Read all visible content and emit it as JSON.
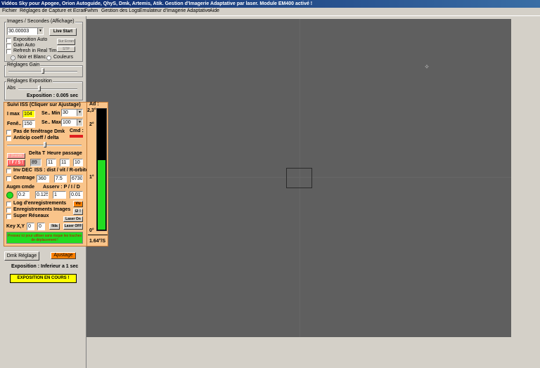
{
  "window": {
    "title": "Vidéos Sky pour Apogee, Orion Autoguide, QhyS, Dmk, Artemis, Atik.    Gestion d'Imagerie Adaptative par laser.    Module EM400 activé !"
  },
  "menu": [
    "Fichier",
    "Réglages de Capture et Ecran",
    "Fwhm",
    "Gestion des Logs",
    "Emulateur d'Imagerie Adaptative",
    "Aide"
  ],
  "images": {
    "group_label": "Images / Secondes (Affichage)",
    "fps_value": "30.00003",
    "live_start": "Live Start",
    "expo_auto": "Exposition Auto",
    "gain_auto": "Gain Auto",
    "refresh": "Refresh in Real Time",
    "sur_ecran": "Sur Ecran",
    "btn_disabled": "STP",
    "noir_blanc": "Noir et Blanc",
    "couleurs": "Couleurs"
  },
  "gain": {
    "group_label": "Réglages Gain",
    "level": 0.5
  },
  "exposure": {
    "group_label": "Réglages Exposition",
    "abs_label": "Abs",
    "level": 0.35,
    "readout": "Exposition :   0.005 sec"
  },
  "iss": {
    "title": "Suivi ISS (Cliquer sur Ajustage)",
    "imax_label": "I max",
    "imax_value": "104",
    "seuil_min_label": "Se.. Min",
    "seuil_min_value": "30",
    "fene_label": "Fenê..",
    "fene_value": "150",
    "seuil_max_label": "Se.. Max",
    "seuil_max_value": "100",
    "pas_fenetrage": "Pas de fenêtrage Dmk",
    "cmd_label": "Cmd :",
    "anticip": "Anticip coeff / delta",
    "btn_top_disabled": "F (Fenêtr.)",
    "btn_fs": "! F / S !",
    "delta_t_label": "Delta T",
    "heure_label": "Heure passage",
    "delta_t_value": "89",
    "hh": "11",
    "mm": "11",
    "ss": "10",
    "inv_dec": "Inv DEC",
    "iss_dist": "ISS : dist / vit / R-orbite",
    "centrage": "Centrage",
    "dist": "360",
    "vit": "7.5",
    "orbit": "6730",
    "augm_label": "Augm cmde",
    "asserv_label": "Asserv : P / I / D",
    "augm_value": "0.2",
    "p_value": "0.125",
    "i_value": "1",
    "d_value": "0.01",
    "log": "Log d'enregistrements",
    "vu": "Vu",
    "enreg": "Enregistrements Images",
    "d_btn": "D !",
    "super": "Super Réseaux",
    "laser_on": "Laser On",
    "key_label": "Key X,Y",
    "key_x": "0",
    "key_y": "0",
    "ilda": "Ilda",
    "laser_off": "Laser OFF",
    "green_msg": "Pressez ici pour utiliser sans risque les touches de déplacement !"
  },
  "ad": {
    "label": "Ad :",
    "t1": "2,3°",
    "t2": "2°",
    "t3": "1°",
    "t4": "0°",
    "speed": "1.64°/S",
    "level": 0.57
  },
  "bottom": {
    "dmk_reglage": "Dmk Réglage",
    "ajustage": "Ajustage",
    "expo_info": "Exposition : Inferieur a 1 sec",
    "expo_status": "EXPOSITION EN COURS !"
  },
  "colors": {
    "iss_panel": "#f9c48a",
    "green": "#22dd22",
    "yellow": "#ffff00",
    "orange": "#ff8000",
    "titlebar": "#0a246a"
  }
}
